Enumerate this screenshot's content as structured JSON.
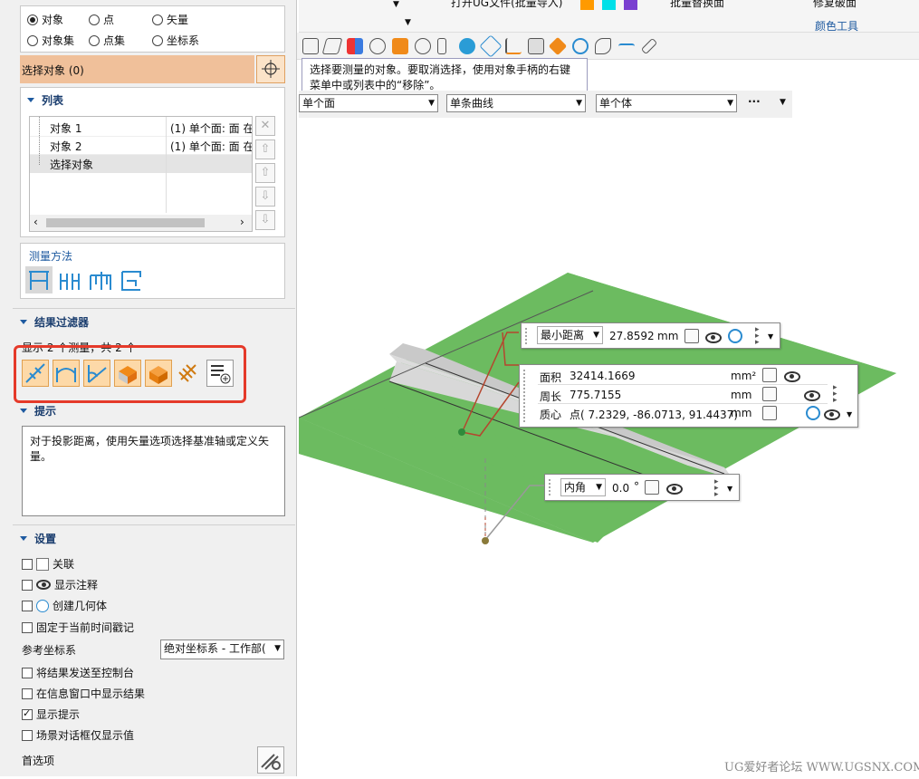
{
  "select_type": {
    "options": [
      {
        "label": "对象",
        "checked": true
      },
      {
        "label": "点",
        "checked": false
      },
      {
        "label": "矢量",
        "checked": false
      },
      {
        "label": "对象集",
        "checked": false
      },
      {
        "label": "点集",
        "checked": false
      },
      {
        "label": "坐标系",
        "checked": false
      }
    ]
  },
  "select_object": {
    "label": "选择对象 (0)"
  },
  "list_section": {
    "title": "列表",
    "rows": [
      {
        "name": "对象 1",
        "value": "(1) 单个面: 面 在"
      },
      {
        "name": "对象 2",
        "value": "(1) 单个面: 面 在"
      },
      {
        "name": "选择对象",
        "value": ""
      }
    ]
  },
  "measure_method": {
    "title": "测量方法"
  },
  "result_filter": {
    "title": "结果过滤器",
    "count_text": "显示 2 个测量，共 2 个"
  },
  "hint": {
    "title": "提示",
    "text": "对于投影距离，使用矢量选项选择基准轴或定义矢量。"
  },
  "settings": {
    "title": "设置",
    "checks": [
      {
        "label": "关联",
        "checked": false
      },
      {
        "label": "显示注释",
        "checked": false
      },
      {
        "label": "创建几何体",
        "checked": false
      },
      {
        "label": "固定于当前时间戳记",
        "checked": false
      }
    ],
    "ref_csys_label": "参考坐标系",
    "ref_csys_value": "绝对坐标系 - 工作部(",
    "checks2": [
      {
        "label": "将结果发送至控制台",
        "checked": false
      },
      {
        "label": "在信息窗口中显示结果",
        "checked": false
      },
      {
        "label": "显示提示",
        "checked": true
      },
      {
        "label": "场景对话框仅显示值",
        "checked": false
      }
    ],
    "preferences_label": "首选项"
  },
  "ribbon": {
    "open_file": "打开UG文件(批量导入)",
    "batch_replace": "批量替换面",
    "repair_face": "修复破面",
    "color_tools": "颜色工具",
    "swatches": [
      "#ff9a00",
      "#00e0e8",
      "#7a3fd0"
    ]
  },
  "tooltip": {
    "text": "选择要测量的对象。要取消选择，使用对象手柄的右键菜单中或列表中的“移除”。"
  },
  "filter_bar": {
    "face": "单个面",
    "curve": "单条曲线",
    "body": "单个体",
    "more": "···"
  },
  "viewport": {
    "min_dist": {
      "label": "最小距离",
      "value": "27.8592",
      "unit": "mm"
    },
    "area": {
      "label": "面积",
      "value": "32414.1669",
      "unit": "mm²"
    },
    "perimeter": {
      "label": "周长",
      "value": "775.7155",
      "unit": "mm"
    },
    "centroid": {
      "label": "质心",
      "value": "点( 7.2329, -86.0713, 91.4437)",
      "unit": "mm"
    },
    "angle": {
      "label": "内角",
      "value": "0.0",
      "unit": "°"
    }
  },
  "watermark": "UG爱好者论坛 WWW.UGSNX.COM"
}
